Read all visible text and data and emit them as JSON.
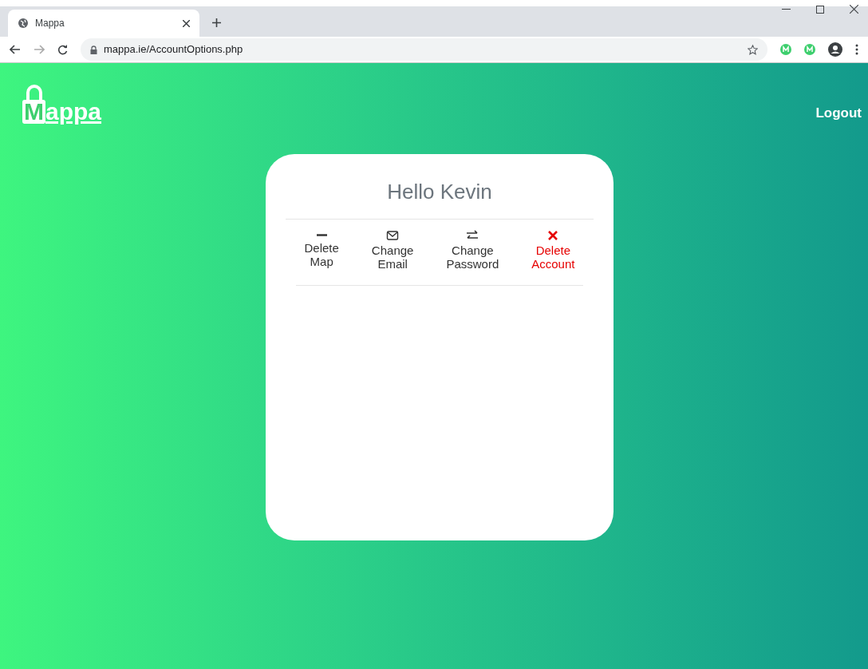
{
  "browser": {
    "tab_title": "Mappa",
    "address": "mappa.ie/AccountOptions.php"
  },
  "header": {
    "logo_letter": "M",
    "logo_rest": "appa",
    "logout": "Logout"
  },
  "card": {
    "greeting": "Hello Kevin",
    "options": [
      {
        "kind": "minus",
        "lines": [
          "Delete",
          "Map"
        ],
        "danger": false
      },
      {
        "kind": "envelope",
        "lines": [
          "Change",
          "Email"
        ],
        "danger": false
      },
      {
        "kind": "swap",
        "lines": [
          "Change",
          "Password"
        ],
        "danger": false
      },
      {
        "kind": "cross",
        "lines": [
          "Delete",
          "Account"
        ],
        "danger": true
      }
    ]
  }
}
